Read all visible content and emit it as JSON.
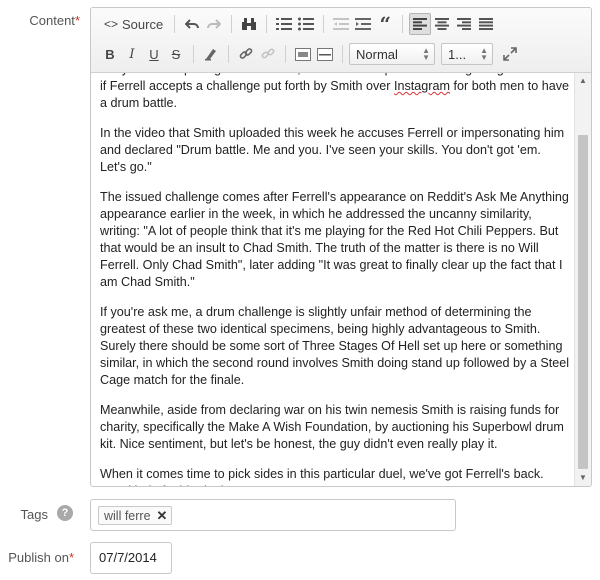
{
  "fields": {
    "content_label": "Content",
    "tags_label": "Tags",
    "publish_label": "Publish on",
    "required_mark": "*",
    "help_glyph": "?"
  },
  "toolbar": {
    "source_label": "Source",
    "format_value": "Normal",
    "size_value": "1..."
  },
  "content": {
    "paragraphs": [
      [
        "likely one man posing as both. Well, the look a like pair are set to get together soon if Ferrell accepts a challenge put forth by Smith over ",
        "Instagram",
        " for both men to have a drum battle."
      ],
      "In the video that Smith uploaded this week he accuses Ferrell or impersonating him and declared \"Drum battle. Me and you. I've seen your skills. You don't got 'em. Let's go.\"",
      "The issued challenge comes after Ferrell's appearance on Reddit's Ask Me Anything appearance earlier in the week, in which he addressed the uncanny similarity, writing: \"A lot of people think that it's me playing for the Red Hot Chili Peppers. But that would be an insult to Chad Smith. The truth of the matter is there is no Will Ferrell. Only Chad Smith\", later adding \"It was great to finally clear up the fact that I am Chad Smith.\"",
      "If you're ask me, a drum challenge is slightly unfair method of determining the greatest of these two identical specimens, being highly advantageous to Smith. Surely there should be some sort of Three Stages Of Hell set up here or something similar, in which the second round involves Smith doing stand up followed by a Steel Cage match for the finale.",
      "Meanwhile, aside from declaring war on his twin nemesis Smith is raising funds for charity, specifically the Make A Wish Foundation, by auctioning his Superbowl drum kit. Nice sentiment, but let's be honest, the guy didn't even really play it.",
      "When it comes time to pick sides in this particular duel, we've got Ferrell's back. He's kind of a big deal."
    ]
  },
  "tags": {
    "items": [
      "will ferre"
    ],
    "remove_glyph": "✕"
  },
  "publish": {
    "date": "07/7/2014"
  }
}
